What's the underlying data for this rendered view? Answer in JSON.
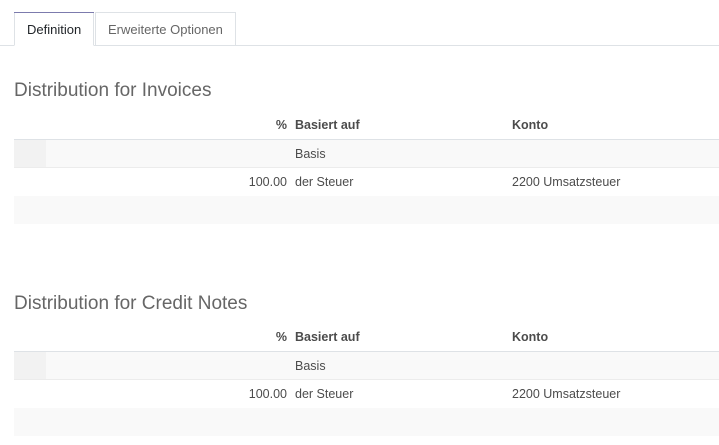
{
  "tabs": [
    {
      "label": "Definition",
      "active": true
    },
    {
      "label": "Erweiterte Optionen",
      "active": false
    }
  ],
  "sections": [
    {
      "title": "Distribution for Invoices",
      "columns": {
        "percent": "%",
        "based_on": "Basiert auf",
        "account": "Konto"
      },
      "rows": [
        {
          "percent": "",
          "based_on": "Basis",
          "account": ""
        },
        {
          "percent": "100.00",
          "based_on": "der Steuer",
          "account": "2200 Umsatzsteuer"
        }
      ]
    },
    {
      "title": "Distribution for Credit Notes",
      "columns": {
        "percent": "%",
        "based_on": "Basiert auf",
        "account": "Konto"
      },
      "rows": [
        {
          "percent": "",
          "based_on": "Basis",
          "account": ""
        },
        {
          "percent": "100.00",
          "based_on": "der Steuer",
          "account": "2200 Umsatzsteuer"
        }
      ]
    }
  ],
  "colors": {
    "tab_accent": "#7c7bad",
    "text": "#4c4c4c",
    "border": "#dee2e6"
  }
}
